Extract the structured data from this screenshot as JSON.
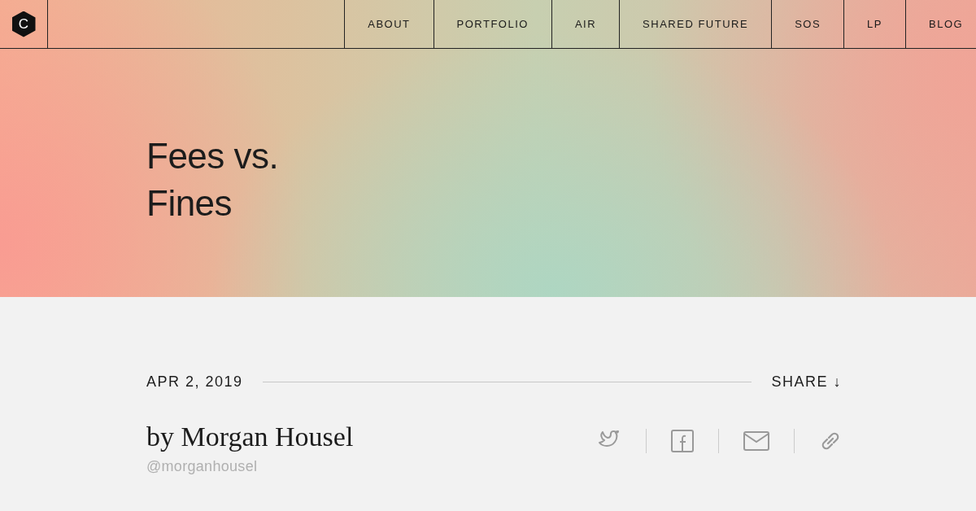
{
  "logo": {
    "letter": "C"
  },
  "nav": {
    "items": [
      {
        "label": "ABOUT"
      },
      {
        "label": "PORTFOLIO"
      },
      {
        "label": "AIR"
      },
      {
        "label": "SHARED FUTURE"
      },
      {
        "label": "SOS"
      },
      {
        "label": "LP"
      },
      {
        "label": "BLOG"
      }
    ]
  },
  "hero": {
    "title_lines": [
      "Fees vs.",
      "Fines"
    ]
  },
  "article": {
    "date": "APR 2, 2019",
    "share": {
      "label": "SHARE",
      "icon": "↓"
    },
    "byline": "by Morgan Housel",
    "handle": "@morganhousel",
    "share_icons": [
      {
        "kind": "bird"
      },
      {
        "kind": "facebook"
      },
      {
        "kind": "mail"
      },
      {
        "kind": "link"
      }
    ]
  }
}
